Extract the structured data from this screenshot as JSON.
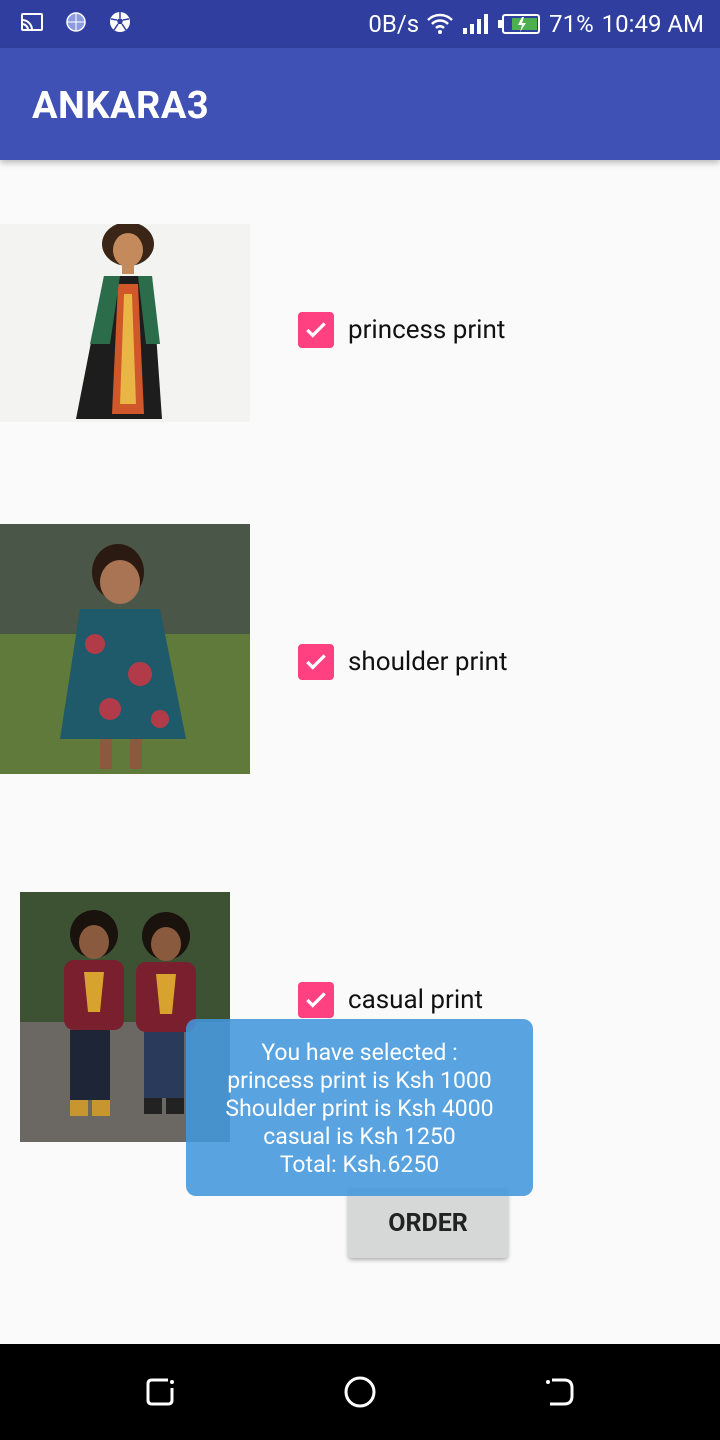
{
  "status_bar": {
    "left_icons": [
      "cast-icon",
      "globe-icon",
      "soccer-ball-icon"
    ],
    "net_speed": "0B/s",
    "battery": "71%",
    "time": "10:49 AM"
  },
  "app_bar": {
    "title": "ANKARA3"
  },
  "items": [
    {
      "label": "princess print",
      "checked": true
    },
    {
      "label": "shoulder print",
      "checked": true
    },
    {
      "label": "casual print",
      "checked": true
    }
  ],
  "order_button": {
    "label": "ORDER"
  },
  "toast": {
    "lines": [
      "You have selected :",
      "princess print is Ksh 1000",
      "Shoulder print is Ksh 4000",
      "casual is Ksh 1250",
      "Total: Ksh.6250"
    ]
  },
  "colors": {
    "primary": "#3f51b5",
    "primary_dark": "#303f9f",
    "accent": "#ff4081",
    "toast": "#4296dc"
  },
  "nav_bar": {
    "icons": [
      "recent-apps-icon",
      "home-icon",
      "back-icon"
    ]
  }
}
